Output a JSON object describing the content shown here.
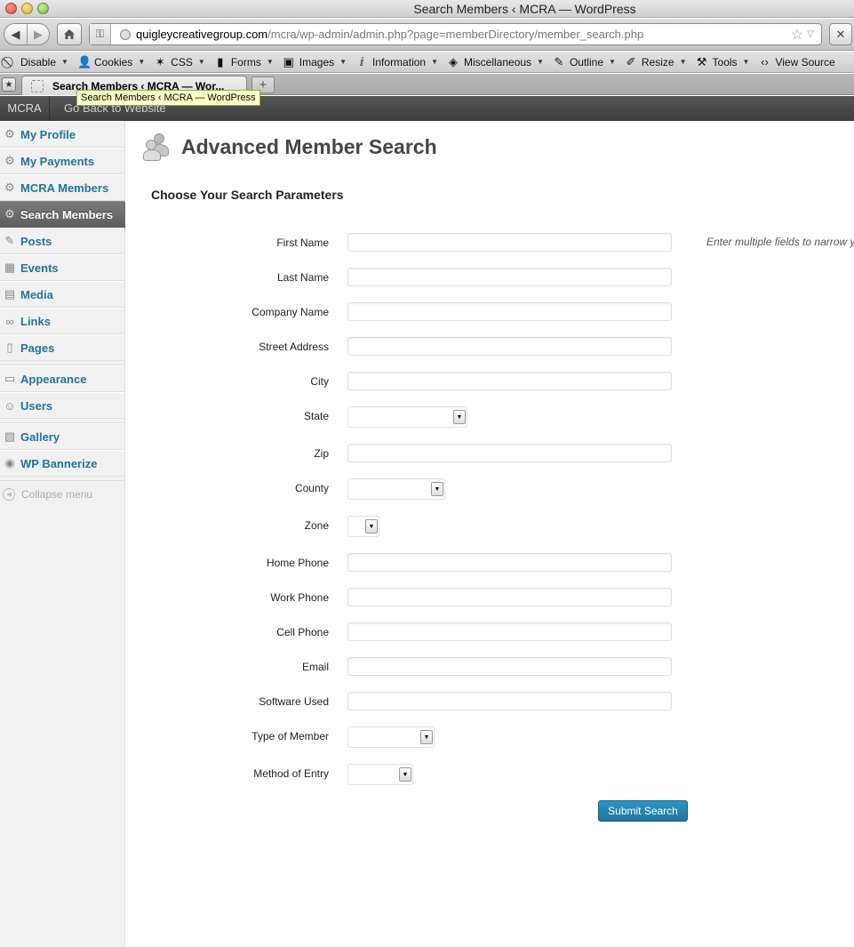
{
  "window": {
    "title": "Search Members ‹ MCRA — WordPress"
  },
  "url": {
    "domain": "quigleycreativegroup.com",
    "path": "/mcra/wp-admin/admin.php?page=memberDirectory/member_search.php"
  },
  "toolbar": {
    "items": [
      "Disable",
      "Cookies",
      "CSS",
      "Forms",
      "Images",
      "Information",
      "Miscellaneous",
      "Outline",
      "Resize",
      "Tools",
      "View Source"
    ],
    "icons": [
      "block-icon",
      "person-icon",
      "wand-icon",
      "clipboard-icon",
      "image-icon",
      "info-icon",
      "cube-icon",
      "pencil-icon",
      "ruler-icon",
      "wrench-icon",
      "code-icon"
    ]
  },
  "tabs": {
    "active_label": "Search Members ‹ MCRA — Wor...",
    "tooltip": "Search Members ‹ MCRA — WordPress",
    "new_tab": "+"
  },
  "adminbar": {
    "site": "MCRA",
    "back": "Go Back to Website"
  },
  "sidebar": {
    "group1": [
      "My Profile",
      "My Payments",
      "MCRA Members",
      "Search Members",
      "Posts",
      "Events",
      "Media",
      "Links",
      "Pages"
    ],
    "group2": [
      "Appearance",
      "Users"
    ],
    "group3": [
      "Gallery",
      "WP Bannerize"
    ],
    "collapse": "Collapse menu",
    "current": "Search Members"
  },
  "page": {
    "title": "Advanced Member Search",
    "section": "Choose Your Search Parameters",
    "hint": "Enter multiple fields to narrow y"
  },
  "form": {
    "first_name": "First Name",
    "last_name": "Last Name",
    "company_name": "Company Name",
    "street_address": "Street Address",
    "city": "City",
    "state": "State",
    "zip": "Zip",
    "county": "County",
    "zone": "Zone",
    "home_phone": "Home Phone",
    "work_phone": "Work Phone",
    "cell_phone": "Cell Phone",
    "email": "Email",
    "software_used": "Software Used",
    "type_of_member": "Type of Member",
    "method_of_entry": "Method of Entry",
    "submit": "Submit Search"
  },
  "colors": {
    "link": "#21759b",
    "button": "#21759b",
    "adminbar": "#464646"
  }
}
